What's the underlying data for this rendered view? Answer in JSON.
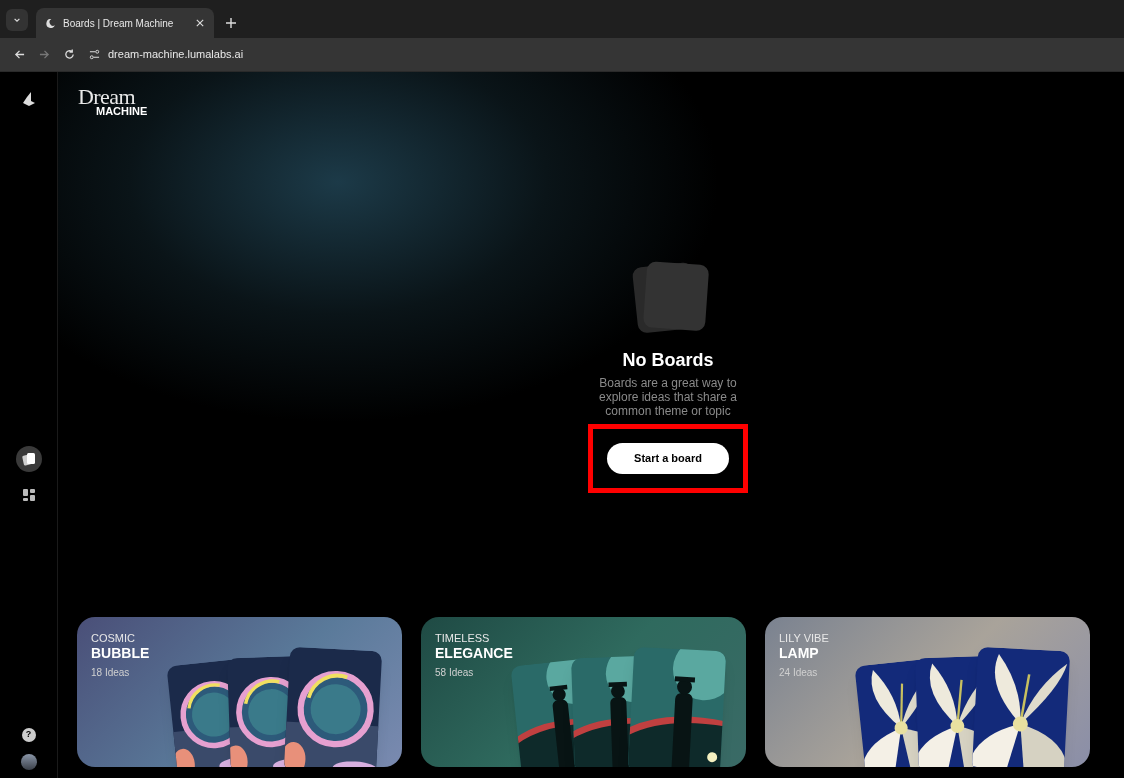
{
  "browser": {
    "tab_title": "Boards | Dream Machine",
    "url": "dream-machine.lumalabs.ai"
  },
  "logo": {
    "top": "Dream",
    "bottom": "MACHINE"
  },
  "sidebar": {
    "items": [
      {
        "kind": "boards",
        "selected": true
      },
      {
        "kind": "grid",
        "selected": false
      }
    ]
  },
  "empty_state": {
    "title": "No Boards",
    "description": "Boards are a great way to explore ideas that share a common theme or topic",
    "button": "Start a board",
    "highlighted": true
  },
  "boards": [
    {
      "eyebrow": "COSMIC",
      "title": "BUBBLE",
      "count": "18 Ideas"
    },
    {
      "eyebrow": "TIMELESS",
      "title": "ELEGANCE",
      "count": "58 Ideas"
    },
    {
      "eyebrow": "LILY VIBE",
      "title": "LAMP",
      "count": "24 Ideas"
    }
  ],
  "help": "?"
}
